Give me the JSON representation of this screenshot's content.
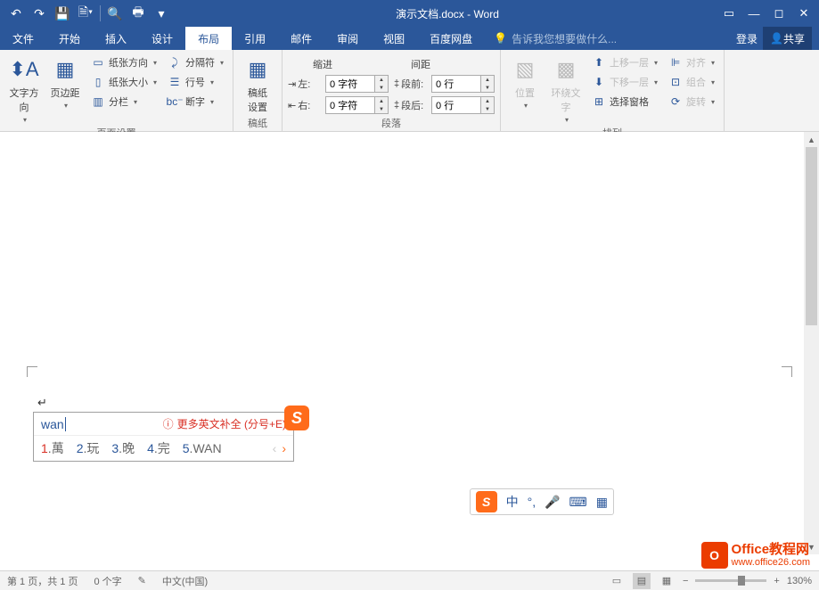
{
  "title": "演示文档.docx - Word",
  "tabs": {
    "file": "文件",
    "home": "开始",
    "insert": "插入",
    "design": "设计",
    "layout": "布局",
    "references": "引用",
    "mailings": "邮件",
    "review": "审阅",
    "view": "视图",
    "baidu": "百度网盘"
  },
  "tellme": "告诉我您想要做什么...",
  "login": "登录",
  "share": "共享",
  "ribbon": {
    "text_direction": "文字方向",
    "margins": "页边距",
    "orientation": "纸张方向",
    "size": "纸张大小",
    "columns": "分栏",
    "breaks": "分隔符",
    "line_numbers": "行号",
    "hyphenation": "断字",
    "page_setup_label": "页面设置",
    "manuscript": "稿纸\n设置",
    "manuscript_label": "稿纸",
    "indent": "缩进",
    "spacing": "间距",
    "left": "左:",
    "right": "右:",
    "before": "段前:",
    "after": "段后:",
    "indent_val": "0 字符",
    "spacing_val": "0 行",
    "paragraph_label": "段落",
    "position": "位置",
    "wrap": "环绕文字",
    "bring_forward": "上移一层",
    "send_backward": "下移一层",
    "selection_pane": "选择窗格",
    "align": "对齐",
    "group": "组合",
    "rotate": "旋转",
    "arrange_label": "排列"
  },
  "ime": {
    "input": "wan",
    "hint": "更多英文补全 (分号+E)",
    "candidates": [
      {
        "num": "1",
        "text": "萬"
      },
      {
        "num": "2",
        "text": "玩"
      },
      {
        "num": "3",
        "text": "晚"
      },
      {
        "num": "4",
        "text": "完"
      },
      {
        "num": "5",
        "text": "WAN"
      }
    ],
    "toolbar_zhong": "中"
  },
  "status": {
    "page": "第 1 页，共 1 页",
    "words": "0 个字",
    "lang": "中文(中国)",
    "zoom": "130%"
  },
  "watermark": {
    "title": "Office教程网",
    "url": "www.office26.com"
  }
}
